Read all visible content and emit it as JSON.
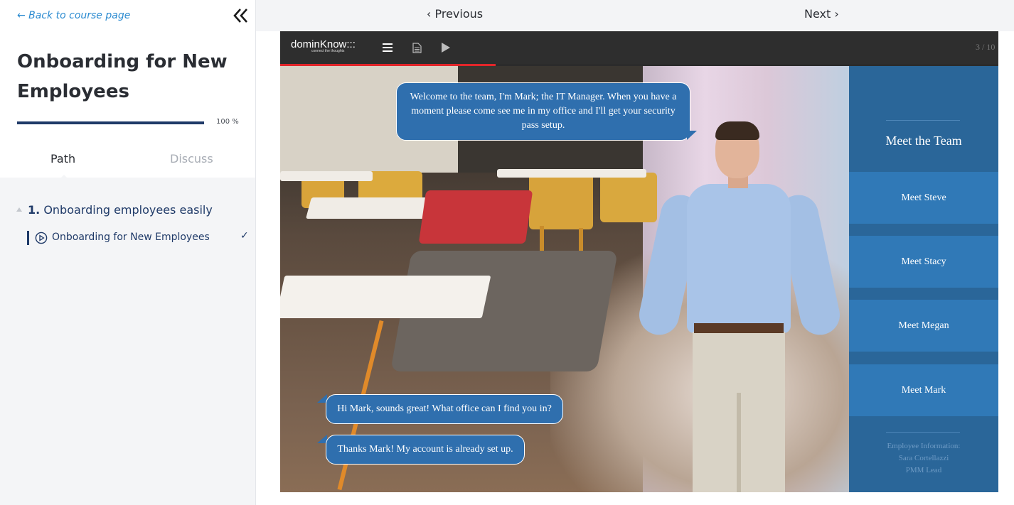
{
  "sidebar": {
    "back_link": "← Back to course page",
    "collapse_icon": "double-chevron-left-icon",
    "course_title": "Onboarding for New Employees",
    "progress": {
      "percent": 100,
      "label": "100 %"
    },
    "tabs": [
      {
        "label": "Path",
        "active": true
      },
      {
        "label": "Discuss",
        "active": false
      }
    ],
    "sections": [
      {
        "number": "1.",
        "title": "Onboarding employees easily",
        "lessons": [
          {
            "icon": "play-circle-icon",
            "label": "Onboarding for New Employees",
            "status": "✓"
          }
        ]
      }
    ]
  },
  "topnav": {
    "previous": "‹ Previous",
    "next": "Next ›"
  },
  "player": {
    "logo_main": "dominKnow:::",
    "logo_tag": "connect the thoughts",
    "counter": "3 / 10",
    "progress_fraction": 0.3,
    "accent_color": "#e2262a",
    "buttons": [
      "menu-icon",
      "document-icon",
      "play-icon"
    ],
    "bubble_main": "Welcome to the team, I'm Mark; the IT Manager. When you have a moment please come see me in my office and I'll get your security pass setup.",
    "choices": [
      "Hi Mark, sounds great! What office can I find you in?",
      "Thanks Mark! My account is already set up."
    ],
    "team_panel": {
      "title": "Meet the Team",
      "buttons": [
        "Meet Steve",
        "Meet Stacy",
        "Meet Megan",
        "Meet Mark"
      ],
      "employee_info": [
        "Employee Information:",
        "Sara Cortellazzi",
        "PMM Lead"
      ]
    }
  }
}
